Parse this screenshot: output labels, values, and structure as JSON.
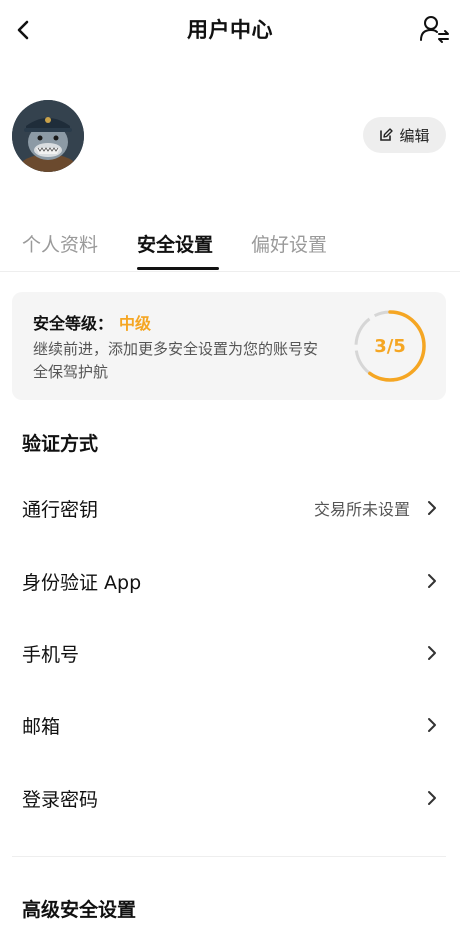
{
  "header": {
    "title": "用户中心",
    "back_icon": "chevron-left-icon",
    "right_icon": "user-switch-icon"
  },
  "profile": {
    "avatar_icon": "shark-avatar",
    "edit_label": "编辑",
    "edit_icon": "pencil-icon"
  },
  "tabs": [
    {
      "label": "个人资料",
      "active": false
    },
    {
      "label": "安全设置",
      "active": true
    },
    {
      "label": "偏好设置",
      "active": false
    }
  ],
  "security": {
    "level_label": "安全等级：",
    "level_value": "中级",
    "description": "继续前进，添加更多安全设置为您的账号安全保驾护航",
    "progress_text": "3/5",
    "progress_fraction": 0.6,
    "accent_color": "#f5a623"
  },
  "verification": {
    "title": "验证方式",
    "items": [
      {
        "label": "通行密钥",
        "value": "交易所未设置"
      },
      {
        "label": "身份验证 App",
        "value": ""
      },
      {
        "label": "手机号",
        "value": ""
      },
      {
        "label": "邮箱",
        "value": ""
      },
      {
        "label": "登录密码",
        "value": ""
      }
    ]
  },
  "advanced": {
    "title": "高级安全设置"
  }
}
